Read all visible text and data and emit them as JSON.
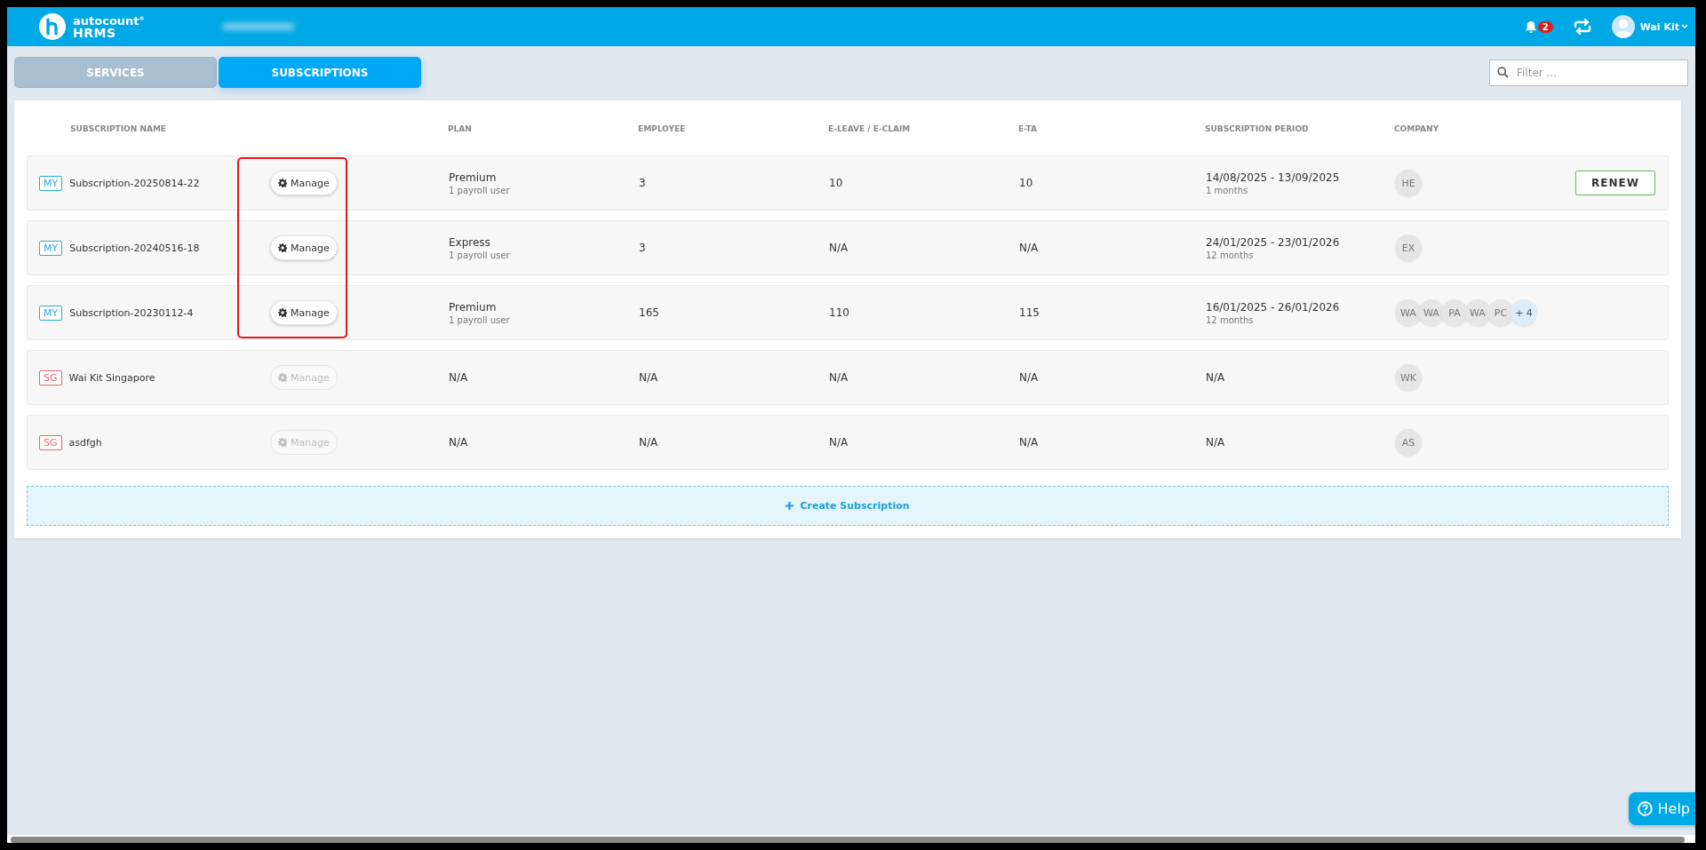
{
  "header": {
    "logo_top": "autocount$^{®}$",
    "logo_bottom": "HRMS",
    "notification_count": "2",
    "user_name": "Wai Kit"
  },
  "tabs": [
    {
      "label": "SERVICES",
      "selected": false
    },
    {
      "label": "SUBSCRIPTIONS",
      "selected": true
    }
  ],
  "filter": {
    "placeholder": "Filter ..."
  },
  "table": {
    "columns": [
      "SUBSCRIPTION NAME",
      "PLAN",
      "EMPLOYEE",
      "E-LEAVE / E-CLAIM",
      "E-TA",
      "SUBSCRIPTION PERIOD",
      "COMPANY"
    ],
    "rows": [
      {
        "region": "MY",
        "color": "#29a9e1",
        "name": "Subscription-20250814-22",
        "manage": {
          "label": "Manage",
          "disabled": false
        },
        "highlighted": true,
        "plan": "Premium",
        "plan_detail": "1 payroll user",
        "employee": "3",
        "e_leave_claim": "10",
        "e_ta": "10",
        "period": "14/08/2025 - 13/09/2025",
        "period_detail": "1 months",
        "companies": [
          {
            "text": "HE",
            "kind": "initials"
          }
        ],
        "action": "RENEW"
      },
      {
        "region": "MY",
        "color": "#29a9e1",
        "name": "Subscription-20240516-18",
        "manage": {
          "label": "Manage",
          "disabled": false
        },
        "highlighted": true,
        "plan": "Express",
        "plan_detail": "1 payroll user",
        "employee": "3",
        "e_leave_claim": "N/A",
        "e_ta": "N/A",
        "period": "24/01/2025 - 23/01/2026",
        "period_detail": "12 months",
        "companies": [
          {
            "text": "EX",
            "kind": "initials"
          }
        ]
      },
      {
        "region": "MY",
        "color": "#29a9e1",
        "name": "Subscription-20230112-4",
        "manage": {
          "label": "Manage",
          "disabled": false
        },
        "highlighted": true,
        "plan": "Premium",
        "plan_detail": "1 payroll user",
        "employee": "165",
        "e_leave_claim": "110",
        "e_ta": "115",
        "period": "16/01/2025 - 26/01/2026",
        "period_detail": "12 months",
        "companies": [
          {
            "text": "WA",
            "kind": "initials"
          },
          {
            "text": "WA",
            "kind": "initials"
          },
          {
            "text": "PA",
            "kind": "initials"
          },
          {
            "text": "WA",
            "kind": "initials"
          },
          {
            "text": "PC",
            "kind": "initials"
          },
          {
            "text": "+ 4",
            "kind": "more"
          }
        ]
      },
      {
        "region": "SG",
        "color": "#e5646b",
        "name": "Wai Kit Singapore",
        "manage": {
          "label": "Manage",
          "disabled": true
        },
        "highlighted": false,
        "plan": "N/A",
        "employee": "N/A",
        "e_leave_claim": "N/A",
        "e_ta": "N/A",
        "period": "N/A",
        "companies": [
          {
            "text": "WK",
            "kind": "initials"
          }
        ]
      },
      {
        "region": "SG",
        "color": "#e5646b",
        "name": "asdfgh",
        "manage": {
          "label": "Manage",
          "disabled": true
        },
        "highlighted": false,
        "plan": "N/A",
        "employee": "N/A",
        "e_leave_claim": "N/A",
        "e_ta": "N/A",
        "period": "N/A",
        "companies": [
          {
            "text": "AS",
            "kind": "initials"
          }
        ]
      }
    ]
  },
  "create_button": "Create Subscription",
  "help": "Help"
}
